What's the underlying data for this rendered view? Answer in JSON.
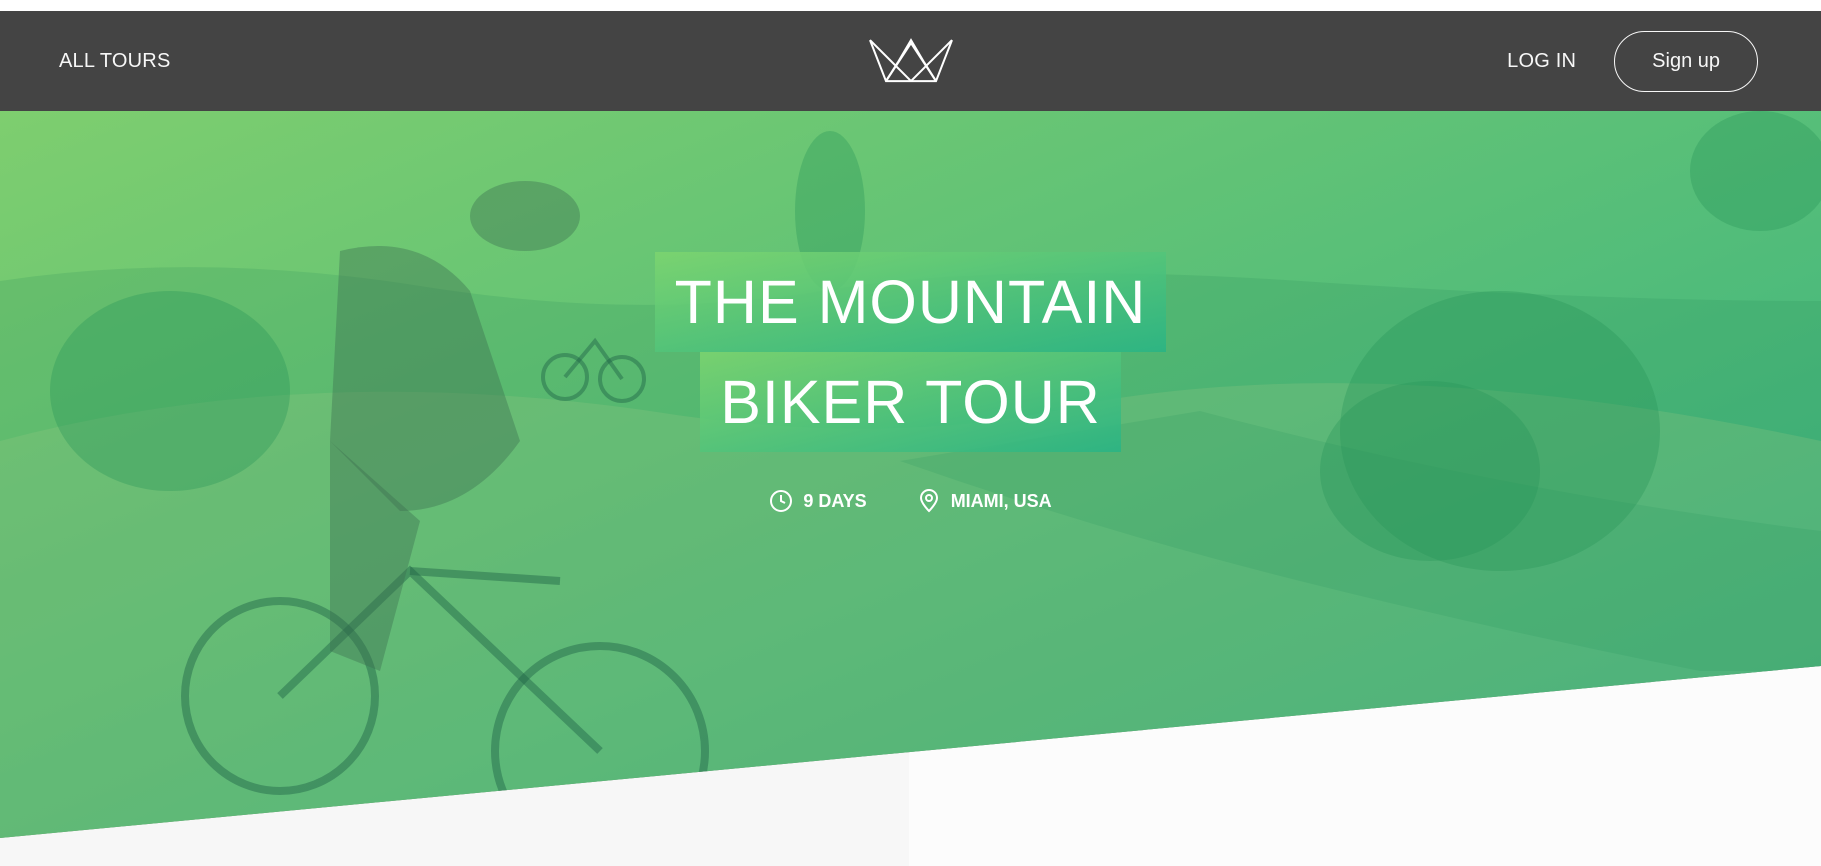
{
  "nav": {
    "all_tours": "All tours",
    "login": "Log in",
    "signup": "Sign up"
  },
  "logo": {
    "icon": "crown-logo-icon"
  },
  "hero": {
    "title_line_1": "The Mountain",
    "title_line_2": "Biker Tour",
    "details": [
      {
        "icon": "clock-icon",
        "text": "9 days"
      },
      {
        "icon": "map-pin-icon",
        "text": "Miami, USA"
      }
    ]
  },
  "colors": {
    "nav_bg": "#444444",
    "gradient_start": "#7dd56f",
    "gradient_end": "#28b487",
    "text_light": "#f7f7f7"
  }
}
